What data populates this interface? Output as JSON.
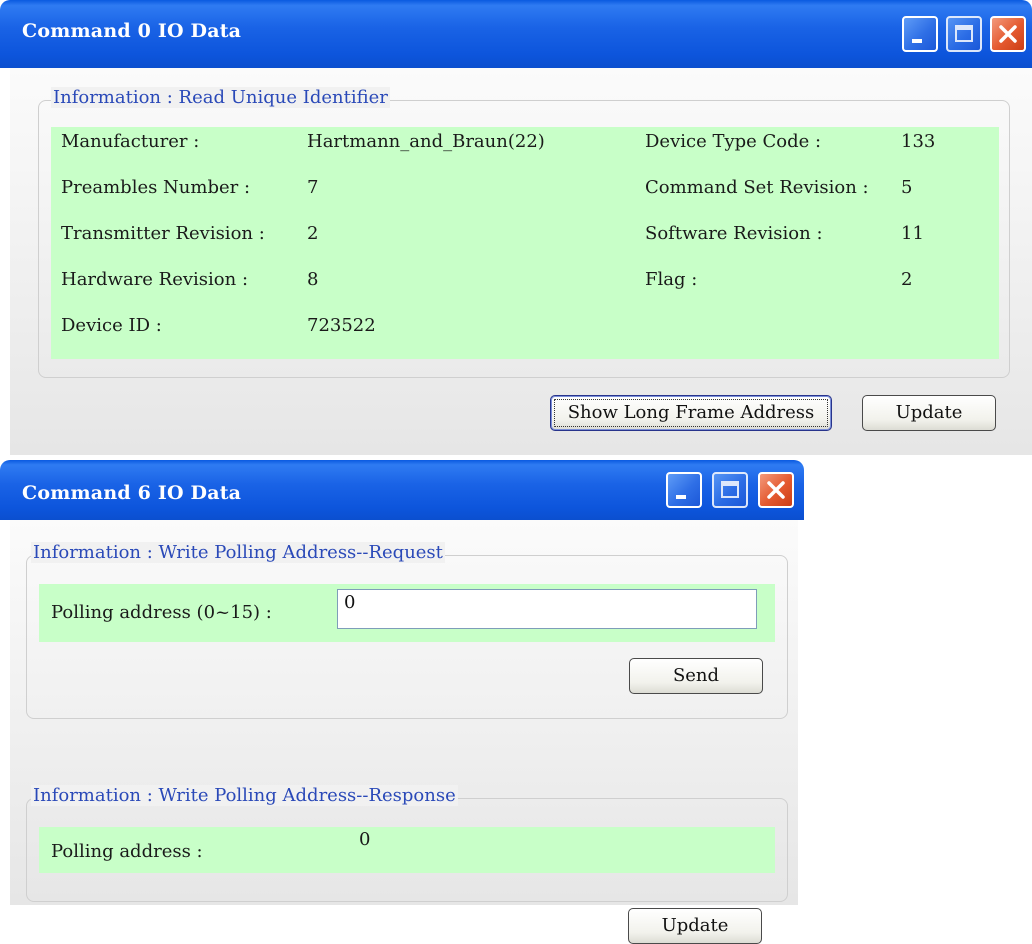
{
  "window0": {
    "title": "Command 0 IO Data",
    "group_title": "Information : Read Unique Identifier",
    "fields": {
      "manufacturer_label": "Manufacturer :",
      "manufacturer_value": "Hartmann_and_Braun(22)",
      "device_type_code_label": "Device Type Code :",
      "device_type_code_value": "133",
      "preambles_label": "Preambles Number :",
      "preambles_value": "7",
      "command_set_label": "Command Set Revision :",
      "command_set_value": "5",
      "transmitter_label": "Transmitter Revision :",
      "transmitter_value": "2",
      "software_label": "Software Revision :",
      "software_value": "11",
      "hardware_label": "Hardware Revision :",
      "hardware_value": "8",
      "flag_label": "Flag :",
      "flag_value": "2",
      "device_id_label": "Device ID :",
      "device_id_value": "723522"
    },
    "buttons": {
      "show_long_frame": "Show Long Frame Address",
      "update": "Update"
    }
  },
  "window6": {
    "title": "Command 6 IO Data",
    "request_group_title": "Information : Write Polling Address--Request",
    "polling_input_label": "Polling address (0~15) :",
    "polling_input_value": "0",
    "send_button": "Send",
    "response_group_title": "Information : Write Polling Address--Response",
    "polling_response_label": "Polling address :",
    "polling_response_value": "0",
    "update_button": "Update"
  },
  "colors": {
    "title_bar": "#0d55dc",
    "field_background": "#c8ffc8",
    "group_title_text": "#2a49b8",
    "close_button": "#e4592f"
  }
}
